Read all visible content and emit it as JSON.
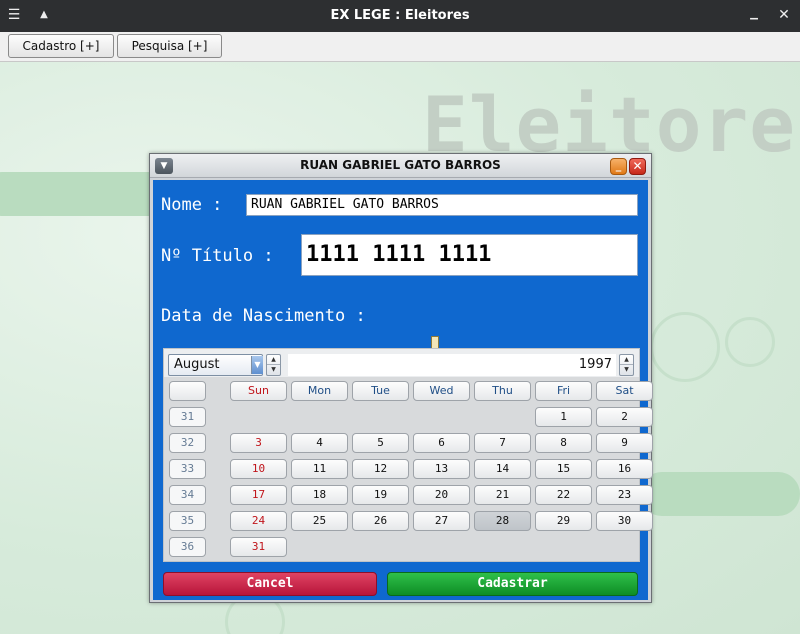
{
  "window": {
    "title": "EX LEGE : Eleitores",
    "menu_icon": "hamburger-icon",
    "up_icon": "triangle-up-icon",
    "minimize_icon": "minimize-icon",
    "close_icon": "close-icon"
  },
  "menubar": {
    "items": [
      {
        "label": "Cadastro [+]"
      },
      {
        "label": "Pesquisa [+]"
      }
    ]
  },
  "background": {
    "title": "Eleitores"
  },
  "dialog": {
    "title": "RUAN GABRIEL GATO BARROS",
    "nome_label": "Nome :",
    "nome_value": "RUAN GABRIEL GATO BARROS",
    "titulo_label": "Nº Título :",
    "titulo_value": "1111 1111 1111",
    "nascimento_label": "Data de Nascimento :",
    "cancel_label": "Cancel",
    "save_label": "Cadastrar",
    "colors": {
      "panel": "#0f68cf",
      "cancel": "#c8173f",
      "save": "#14a12f"
    }
  },
  "calendar": {
    "month": "August",
    "year": "1997",
    "weekdays": [
      "Sun",
      "Mon",
      "Tue",
      "Wed",
      "Thu",
      "Fri",
      "Sat"
    ],
    "weeks": [
      {
        "week": "31",
        "days": [
          "",
          "",
          "",
          "",
          "",
          "1",
          "2"
        ]
      },
      {
        "week": "32",
        "days": [
          "3",
          "4",
          "5",
          "6",
          "7",
          "8",
          "9"
        ]
      },
      {
        "week": "33",
        "days": [
          "10",
          "11",
          "12",
          "13",
          "14",
          "15",
          "16"
        ]
      },
      {
        "week": "34",
        "days": [
          "17",
          "18",
          "19",
          "20",
          "21",
          "22",
          "23"
        ]
      },
      {
        "week": "35",
        "days": [
          "24",
          "25",
          "26",
          "27",
          "28",
          "29",
          "30"
        ]
      },
      {
        "week": "36",
        "days": [
          "31",
          "",
          "",
          "",
          "",
          "",
          ""
        ]
      }
    ],
    "selected_day": "28"
  }
}
